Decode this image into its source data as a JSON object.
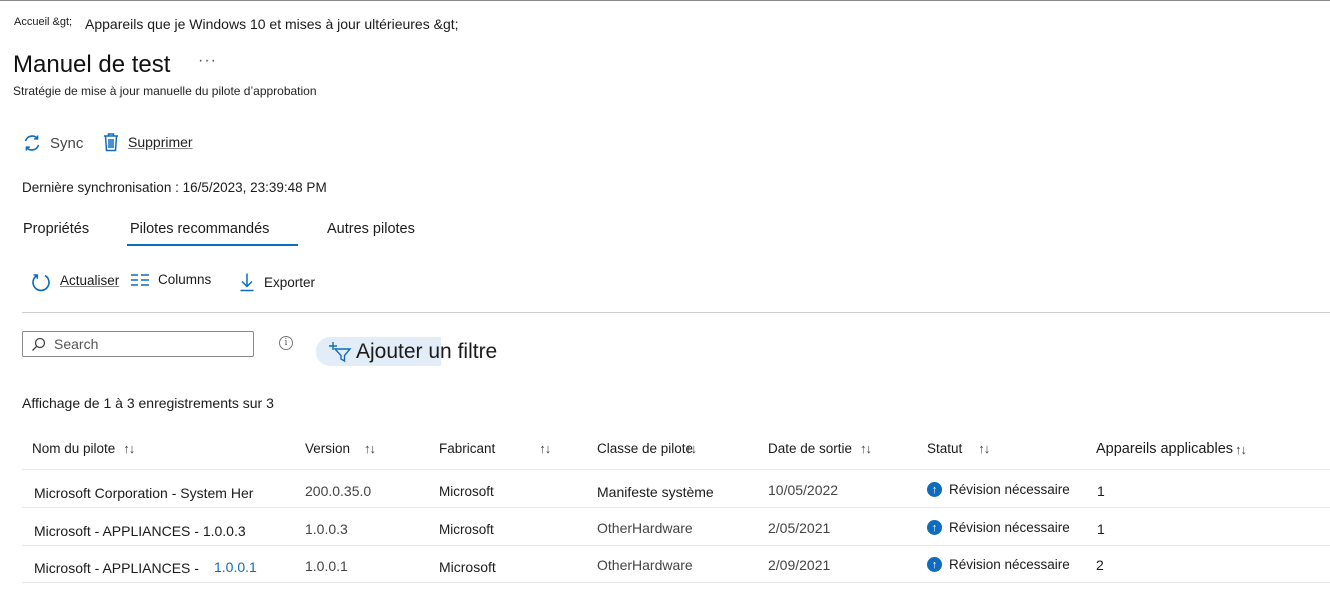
{
  "breadcrumb": {
    "home": "Accueil &gt;",
    "page": "Appareils que je Windows 10 et mises à jour ultérieures &gt;"
  },
  "header": {
    "title": "Manuel de test",
    "more": "···",
    "subtitle": "Stratégie de mise à jour manuelle du pilote d’approbation"
  },
  "actions": {
    "sync": "Sync",
    "delete": "Supprimer"
  },
  "last_sync": "Dernière synchronisation : 16/5/2023, 23:39:48 PM",
  "tabs": [
    {
      "label": "Propriétés"
    },
    {
      "label": "Pilotes recommandés"
    },
    {
      "label": "Autres pilotes"
    }
  ],
  "commands": {
    "refresh": "Actualiser",
    "columns": "Columns",
    "export": "Exporter"
  },
  "search": {
    "placeholder": "Search",
    "value": ""
  },
  "filter": {
    "label": "Ajouter un filtre"
  },
  "records": "Affichage de 1 à 3 enregistrements sur 3",
  "table": {
    "columns": [
      {
        "label": "Nom du pilote"
      },
      {
        "label": "Version"
      },
      {
        "label": "Fabricant"
      },
      {
        "label": "Classe de pilote"
      },
      {
        "label": "Date de sortie"
      },
      {
        "label": "Statut"
      },
      {
        "label": "Appareils applicables"
      }
    ],
    "rows": [
      {
        "name": "Microsoft Corporation - System Her",
        "name_link": "",
        "version": "200.0.35.0",
        "maker": "Microsoft",
        "class": "Manifeste système",
        "date": "10/05/2022",
        "status": "Révision nécessaire",
        "devices": "1"
      },
      {
        "name": "Microsoft - APPLIANCES - 1.0.0.3",
        "name_link": "",
        "version": "1.0.0.3",
        "maker": "Microsoft",
        "class": "OtherHardware",
        "date": "2/05/2021",
        "status": "Révision nécessaire",
        "devices": "1"
      },
      {
        "name": "Microsoft - APPLIANCES -",
        "name_link": "1.0.0.1",
        "version": "1.0.0.1",
        "maker": "Microsoft",
        "class": "OtherHardware",
        "date": "2/09/2021",
        "status": "Révision nécessaire",
        "devices": "2"
      }
    ]
  },
  "colors": {
    "accent": "#0f6cbd"
  },
  "icons": {
    "sync": "sync-icon",
    "delete": "trash-icon",
    "refresh": "refresh-icon",
    "columns": "columns-icon",
    "export": "download-icon",
    "search": "search-icon",
    "info": "info-icon",
    "filter": "add-filter-icon",
    "status": "arrow-up-circle-icon",
    "sort": "sort-arrows-icon"
  }
}
